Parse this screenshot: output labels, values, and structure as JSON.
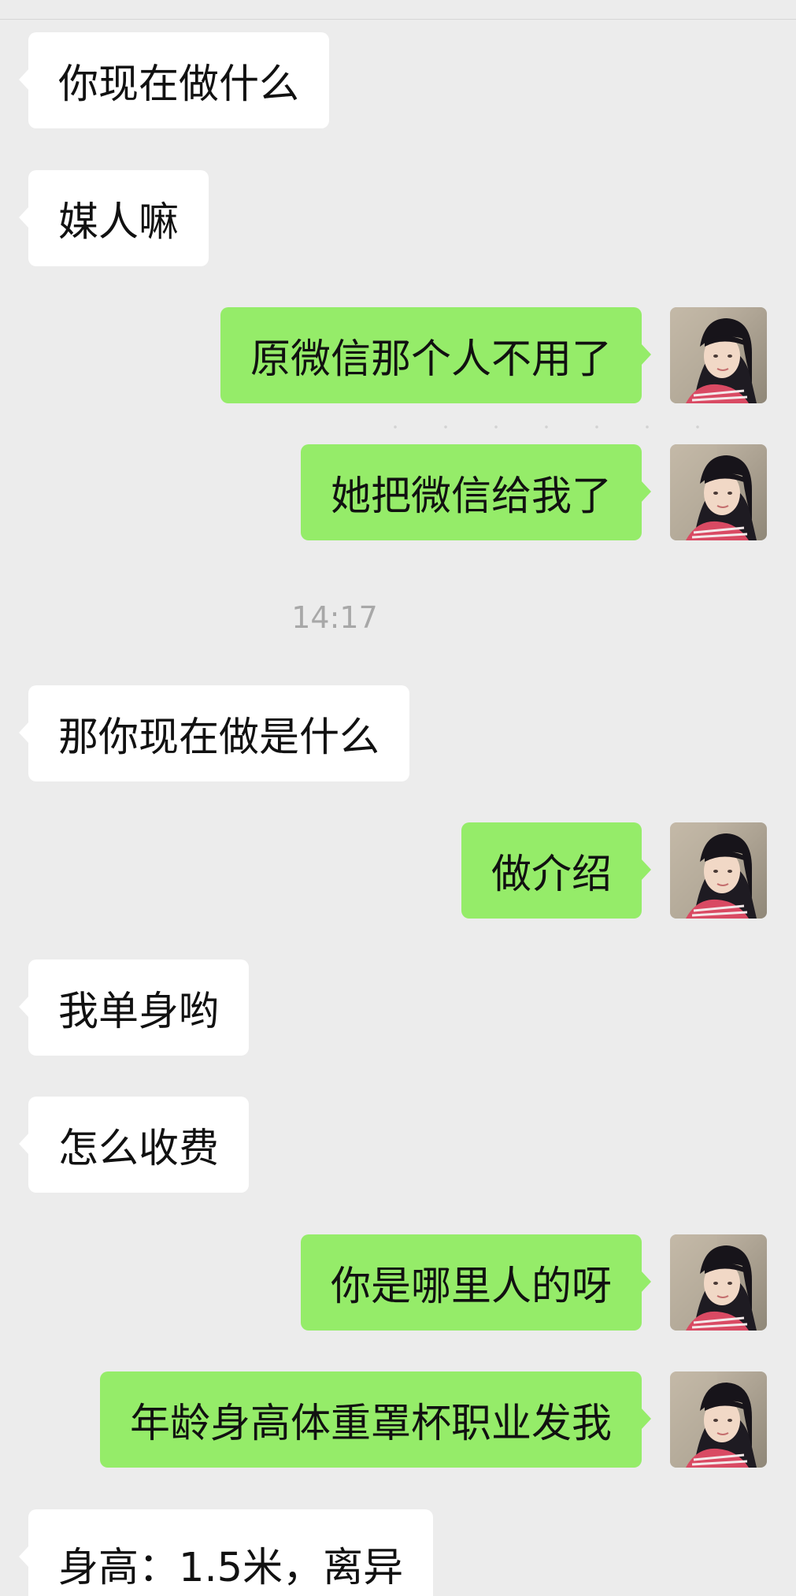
{
  "chat": {
    "timestamp": "14:17",
    "messages": [
      {
        "side": "in",
        "text": "你现在做什么"
      },
      {
        "side": "in",
        "text": "媒人嘛"
      },
      {
        "side": "out",
        "text": "原微信那个人不用了"
      },
      {
        "side": "out",
        "text": "她把微信给我了"
      },
      {
        "side": "in",
        "text": "那你现在做是什么"
      },
      {
        "side": "out",
        "text": "做介绍"
      },
      {
        "side": "in",
        "text": "我单身哟"
      },
      {
        "side": "in",
        "text": "怎么收费"
      },
      {
        "side": "out",
        "text": "你是哪里人的呀"
      },
      {
        "side": "out",
        "text": "年龄身高体重罩杯职业发我"
      },
      {
        "side": "in",
        "text": "身高：1.5米，离异"
      }
    ]
  },
  "colors": {
    "background": "#ececec",
    "incoming_bubble": "#ffffff",
    "outgoing_bubble": "#95ec69",
    "timestamp_text": "#a8a8a8"
  },
  "icons": {
    "own_avatar": "avatar-photo-girl-bangs"
  }
}
